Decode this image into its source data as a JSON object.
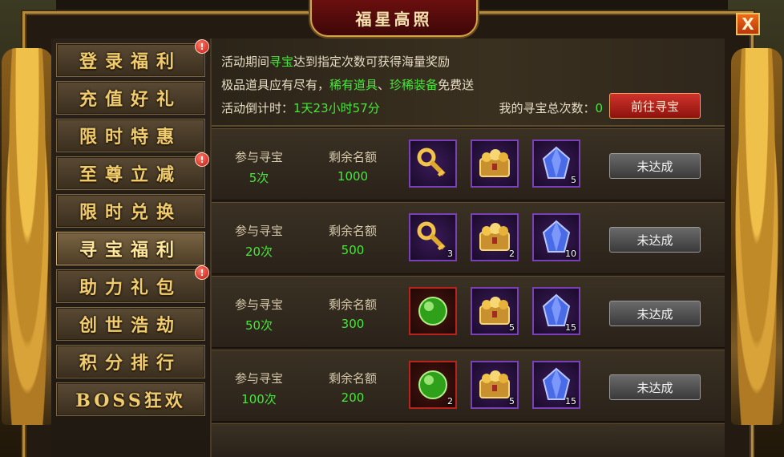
{
  "window": {
    "title": "福星高照",
    "close_label": "X"
  },
  "sidebar": {
    "items": [
      {
        "label": "登录福利",
        "badge": "!"
      },
      {
        "label": "充值好礼",
        "badge": ""
      },
      {
        "label": "限时特惠",
        "badge": ""
      },
      {
        "label": "至尊立减",
        "badge": "!"
      },
      {
        "label": "限时兑换",
        "badge": ""
      },
      {
        "label": "寻宝福利",
        "badge": "",
        "active": true
      },
      {
        "label": "助力礼包",
        "badge": "!"
      },
      {
        "label": "创世浩劫",
        "badge": ""
      },
      {
        "label": "积分排行",
        "badge": ""
      },
      {
        "label": "BOSS狂欢",
        "badge": ""
      }
    ]
  },
  "info": {
    "line1_prefix": "活动期间",
    "line1_highlight": "寻宝",
    "line1_suffix": "达到指定次数可获得海量奖励",
    "line2_prefix": "极品道具应有尽有，",
    "line2_highlight1": "稀有道具",
    "line2_sep": "、",
    "line2_highlight2": "珍稀装备",
    "line2_suffix": "免费送",
    "timer_label": "活动倒计时：",
    "timer_value": "1天23小时57分",
    "count_label": "我的寻宝总次数：",
    "count_value": "0",
    "go_button": "前往寻宝"
  },
  "rows": [
    {
      "label_join": "参与寻宝",
      "times": "5次",
      "label_remain": "剩余名额",
      "remain": "1000",
      "items": [
        {
          "icon": "golden-key-icon",
          "count": ""
        },
        {
          "icon": "gold-chest-icon",
          "count": ""
        },
        {
          "icon": "blue-crystal-icon",
          "count": "5"
        }
      ],
      "status": "未达成"
    },
    {
      "label_join": "参与寻宝",
      "times": "20次",
      "label_remain": "剩余名额",
      "remain": "500",
      "items": [
        {
          "icon": "golden-key-icon",
          "count": "3"
        },
        {
          "icon": "gold-chest-icon",
          "count": "2"
        },
        {
          "icon": "blue-crystal-icon",
          "count": "10"
        }
      ],
      "status": "未达成"
    },
    {
      "label_join": "参与寻宝",
      "times": "50次",
      "label_remain": "剩余名额",
      "remain": "300",
      "items": [
        {
          "icon": "green-orb-icon",
          "count": ""
        },
        {
          "icon": "gold-chest-icon",
          "count": "5"
        },
        {
          "icon": "blue-crystal-icon",
          "count": "15"
        }
      ],
      "status": "未达成"
    },
    {
      "label_join": "参与寻宝",
      "times": "100次",
      "label_remain": "剩余名额",
      "remain": "200",
      "items": [
        {
          "icon": "green-orb-icon",
          "count": "2"
        },
        {
          "icon": "gold-chest-icon",
          "count": "5"
        },
        {
          "icon": "blue-crystal-icon",
          "count": "15"
        }
      ],
      "status": "未达成"
    }
  ],
  "colors": {
    "highlight_green": "#46e83a",
    "frame_gold": "#b48a3c",
    "title_red": "#6b0f0f"
  }
}
